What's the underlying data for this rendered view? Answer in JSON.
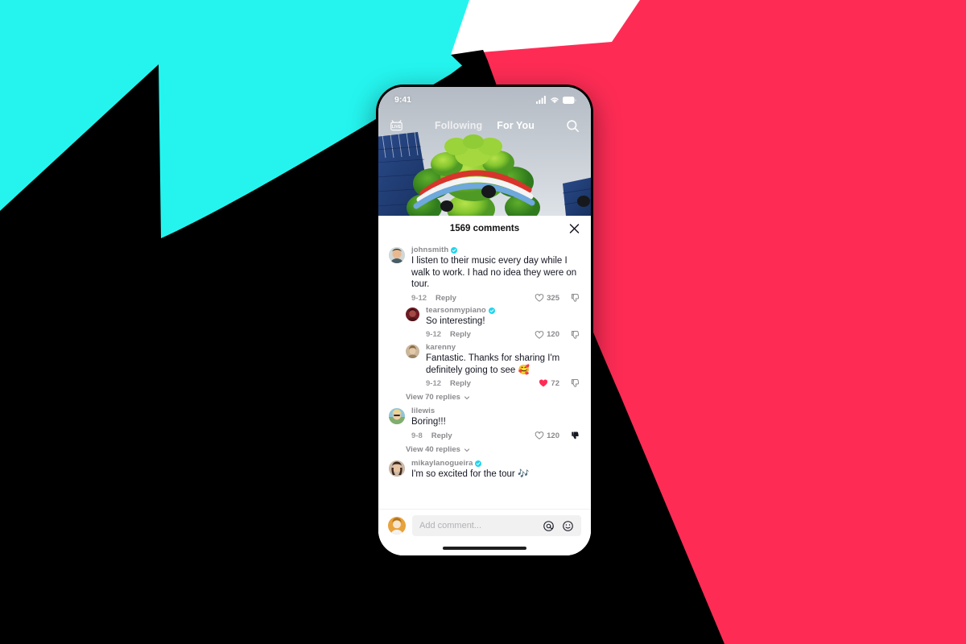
{
  "background": {
    "cyan": "#25F4EE",
    "red": "#FE2C55",
    "black": "#000000",
    "white": "#FFFFFF"
  },
  "phone": {
    "status_bar": {
      "time": "9:41",
      "signal_icon": "cellular-signal-icon",
      "wifi_icon": "wifi-icon",
      "battery_icon": "battery-icon"
    },
    "top_nav": {
      "live_label": "LIVE",
      "tabs": [
        {
          "label": "Following",
          "active": false
        },
        {
          "label": "For You",
          "active": true
        }
      ],
      "search_icon": "search-icon"
    },
    "home_indicator": "home-indicator"
  },
  "comments_sheet": {
    "title": "1569 comments",
    "close_icon": "close-icon",
    "comments": [
      {
        "username": "johnsmith",
        "verified": true,
        "text": "I listen to their music every day while I walk to work. I had no idea they were on tour.",
        "date": "9-12",
        "reply_label": "Reply",
        "likes": "325",
        "liked": false,
        "disliked": false,
        "level": 0
      },
      {
        "username": "tearsonmypiano",
        "verified": true,
        "text": "So interesting!",
        "date": "9-12",
        "reply_label": "Reply",
        "likes": "120",
        "liked": false,
        "disliked": false,
        "level": 1
      },
      {
        "username": "karenny",
        "verified": false,
        "text": "Fantastic. Thanks for sharing I'm definitely going to see 🥰",
        "date": "9-12",
        "reply_label": "Reply",
        "likes": "72",
        "liked": true,
        "disliked": false,
        "level": 1
      }
    ],
    "view_replies_1": "View 70 replies",
    "comment_lilewis": {
      "username": "lilewis",
      "verified": false,
      "text": "Boring!!!",
      "date": "9-8",
      "reply_label": "Reply",
      "likes": "120",
      "liked": false,
      "disliked": true,
      "level": 0
    },
    "view_replies_2": "View 40 replies",
    "comment_mikayla": {
      "username": "mikaylanogueira",
      "verified": true,
      "text": "I'm so excited for the tour 🎶",
      "level": 0
    }
  },
  "input_bar": {
    "placeholder": "Add comment...",
    "mention_icon": "at-mention-icon",
    "emoji_icon": "emoji-smiley-icon",
    "avatar": "user-avatar"
  }
}
